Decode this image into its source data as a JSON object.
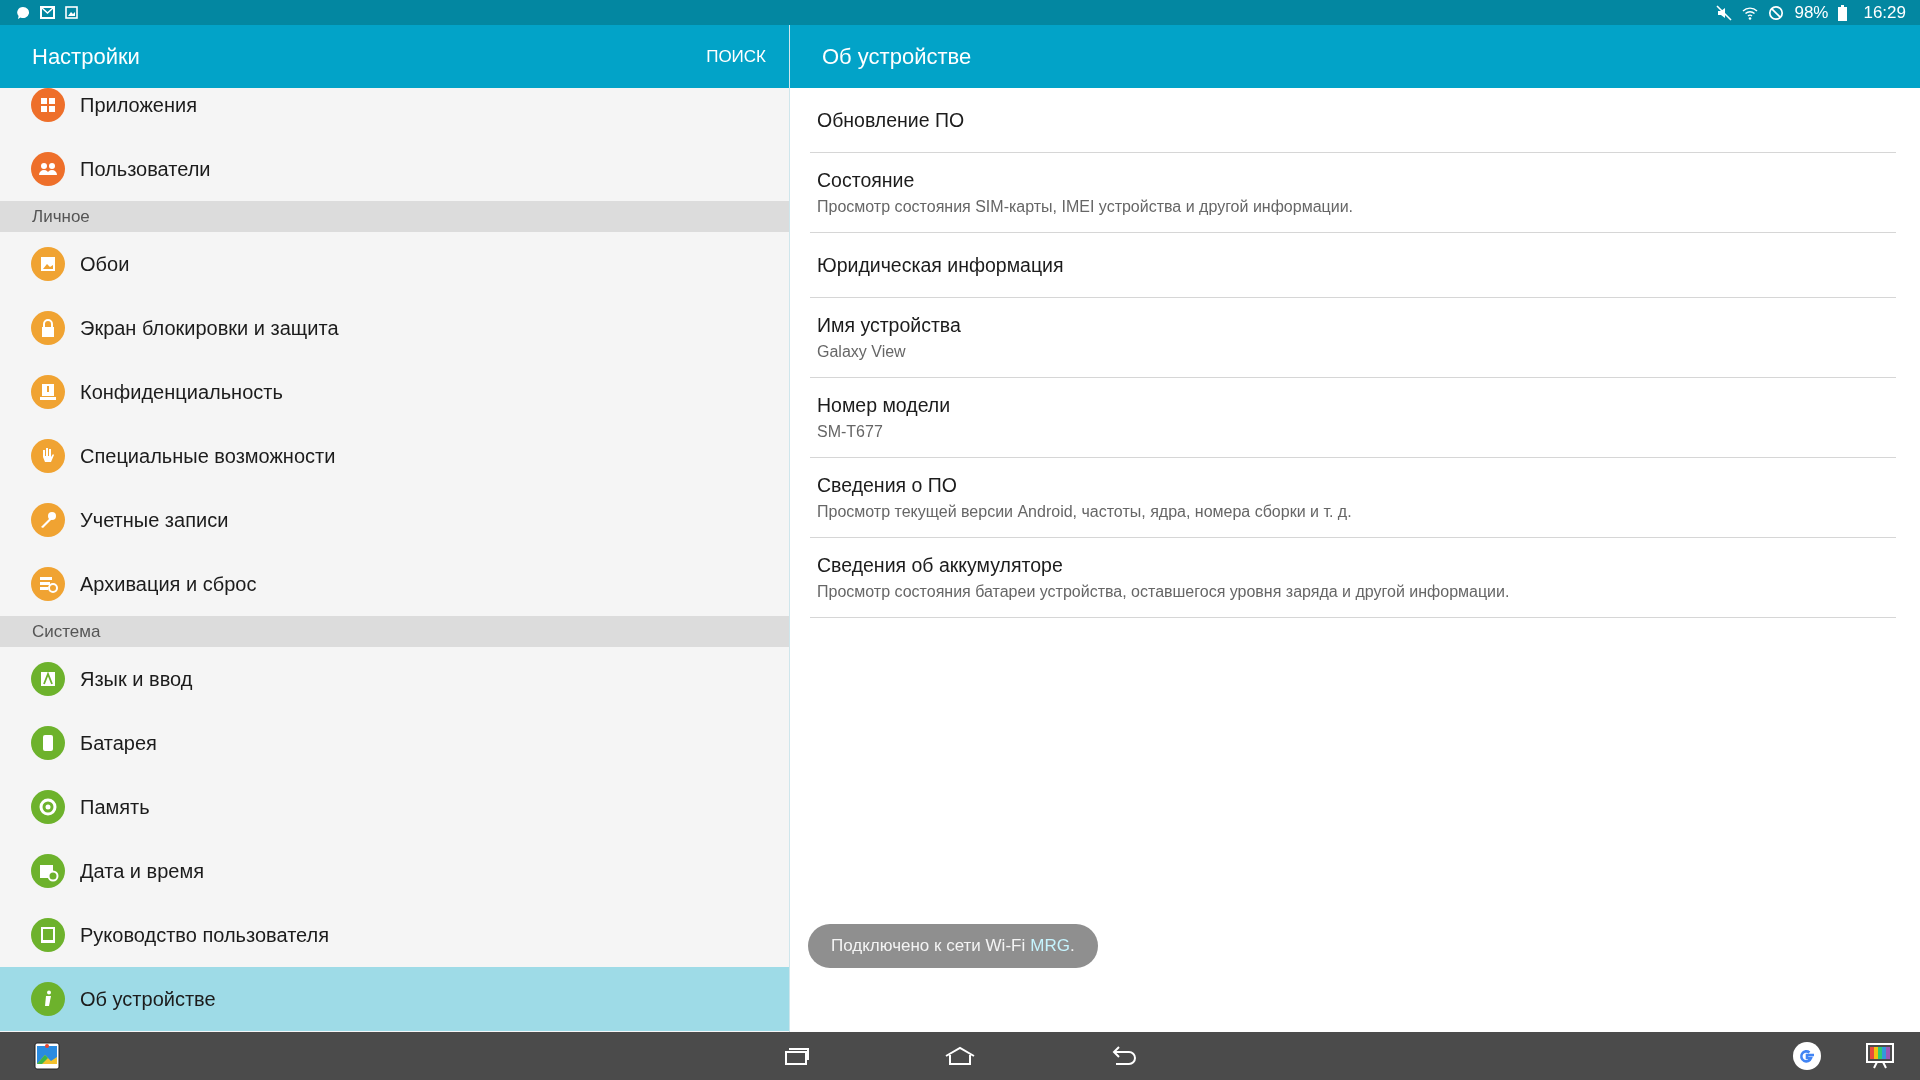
{
  "status_bar": {
    "battery": "98%",
    "time": "16:29"
  },
  "settings_panel": {
    "title": "Настройки",
    "search_button": "ПОИСК",
    "groups": [
      {
        "items": [
          {
            "label": "Приложения",
            "color": "#ee6f2a",
            "selected": false
          },
          {
            "label": "Пользователи",
            "color": "#ee6f2a",
            "selected": false
          }
        ]
      },
      {
        "header": "Личное",
        "items": [
          {
            "label": "Обои",
            "color": "#f0a332",
            "selected": false
          },
          {
            "label": "Экран блокировки и защита",
            "color": "#f0a332",
            "selected": false
          },
          {
            "label": "Конфиденциальность",
            "color": "#f0a332",
            "selected": false
          },
          {
            "label": "Специальные возможности",
            "color": "#f0a332",
            "selected": false
          },
          {
            "label": "Учетные записи",
            "color": "#f0a332",
            "selected": false
          },
          {
            "label": "Архивация и сброс",
            "color": "#f0a332",
            "selected": false
          }
        ]
      },
      {
        "header": "Система",
        "items": [
          {
            "label": "Язык и ввод",
            "color": "#6db22c",
            "selected": false
          },
          {
            "label": "Батарея",
            "color": "#6db22c",
            "selected": false
          },
          {
            "label": "Память",
            "color": "#6db22c",
            "selected": false
          },
          {
            "label": "Дата и время",
            "color": "#6db22c",
            "selected": false
          },
          {
            "label": "Руководство пользователя",
            "color": "#6db22c",
            "selected": false
          },
          {
            "label": "Об устройстве",
            "color": "#6db22c",
            "selected": true
          }
        ]
      }
    ]
  },
  "detail_panel": {
    "title": "Об устройстве",
    "items": [
      {
        "title": "Обновление ПО"
      },
      {
        "title": "Состояние",
        "summary": "Просмотр состояния SIM-карты, IMEI устройства и другой информации."
      },
      {
        "title": "Юридическая информация"
      },
      {
        "title": "Имя устройства",
        "summary": "Galaxy View"
      },
      {
        "title": "Номер модели",
        "summary": "SM-T677"
      },
      {
        "title": "Сведения о ПО",
        "summary": "Просмотр текущей версии Android, частоты, ядра, номера сборки и т. д."
      },
      {
        "title": "Сведения об аккумуляторе",
        "summary": "Просмотр состояния батареи устройства, оставшегося уровня заряда и другой информации."
      }
    ]
  },
  "toast": {
    "text": "Подключено к сети Wi-Fi",
    "network": "MRG",
    "suffix": "."
  }
}
